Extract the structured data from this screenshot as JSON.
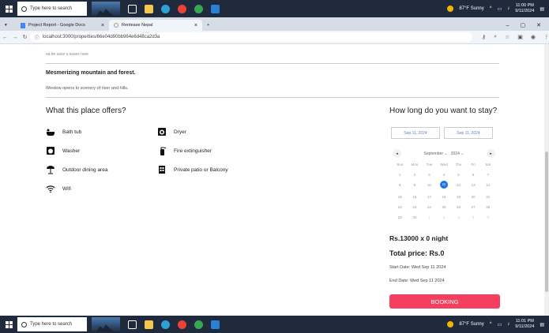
{
  "taskbar": {
    "search_placeholder": "Type here to search",
    "weather": "87°F Sunny",
    "time_top": "11:00 PM",
    "time_bottom": "11:01 PM",
    "date": "9/11/2024"
  },
  "browser": {
    "tabs": [
      {
        "label": "Project Report - Google Docs"
      },
      {
        "label": "Rentease Nepal"
      }
    ],
    "new_tab": "+",
    "url": "localhost:3000/properties/66e04d90bb964e6d48ca2d3a"
  },
  "page": {
    "cutoff_text": "ea ite sace u ssues rsee",
    "mesmerizing_title": "Mesmerizing mountain and forest.",
    "mesmerizing_desc": "Window opens to scenery of river and hills.",
    "offers_heading": "What this place offers?",
    "amenities": [
      {
        "label": "Bath tub",
        "icon": "bathtub-icon"
      },
      {
        "label": "Dryer",
        "icon": "dryer-icon"
      },
      {
        "label": "Washer",
        "icon": "washer-icon"
      },
      {
        "label": "Fire extinguisher",
        "icon": "fire-extinguisher-icon"
      },
      {
        "label": "Outdoor dining area",
        "icon": "umbrella-table-icon"
      },
      {
        "label": "Private patio or Balcony",
        "icon": "building-icon"
      },
      {
        "label": "Wifi",
        "icon": "wifi-icon"
      }
    ],
    "stay_heading": "How long do you want to stay?",
    "start_input": "Sep 11, 2024",
    "end_input": "Sep 11, 2024",
    "calendar": {
      "month": "September",
      "year": "2024",
      "weekdays": [
        "Sun",
        "Mon",
        "Tue",
        "Wed",
        "Thu",
        "Fri",
        "Sat"
      ],
      "days": [
        "1",
        "2",
        "3",
        "4",
        "5",
        "6",
        "7",
        "8",
        "9",
        "10",
        "11",
        "12",
        "13",
        "14",
        "15",
        "16",
        "17",
        "18",
        "19",
        "20",
        "21",
        "22",
        "23",
        "24",
        "25",
        "26",
        "27",
        "28",
        "29",
        "30",
        "1",
        "2",
        "3",
        "4",
        "5"
      ],
      "selected": "11"
    },
    "price_line": "Rs.13000 x 0 night",
    "total_price": "Total price: Rs.0",
    "start_date": "Start Date: Wed Sep 11 2024",
    "end_date": "End Date: Wed Sep 11 2024",
    "booking_button": "BOOKING"
  },
  "colors": {
    "accent": "#f43f5e",
    "selected_day": "#1a73e8",
    "taskbar": "#1f2b3c"
  }
}
